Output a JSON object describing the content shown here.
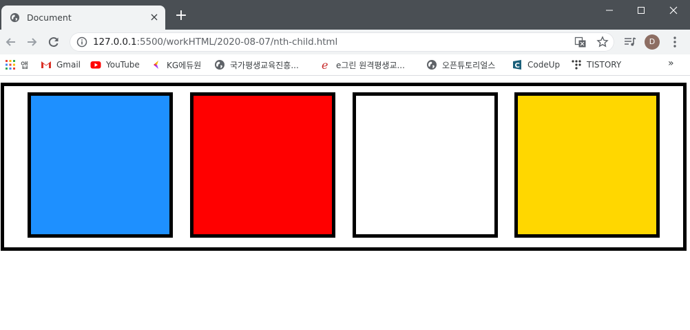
{
  "tab": {
    "title": "Document",
    "close": "×"
  },
  "new_tab": "+",
  "omnibox": {
    "host": "127.0.0.1",
    "path": ":5500/workHTML/2020-08-07/nth-child.html"
  },
  "profile": {
    "initial": "D",
    "color": "#8d6e63"
  },
  "bookmarks": [
    {
      "label": "앱",
      "icon": "apps-grid-icon"
    },
    {
      "label": "Gmail",
      "icon": "gmail-icon"
    },
    {
      "label": "YouTube",
      "icon": "youtube-icon"
    },
    {
      "label": "KG에듀원",
      "icon": "kg-icon"
    },
    {
      "label": "국가평생교육진흥...",
      "icon": "globe-icon"
    },
    {
      "label": "e그린 원격평생교...",
      "icon": "e-icon"
    },
    {
      "label": "오픈튜토리얼스",
      "icon": "globe-icon"
    },
    {
      "label": "CodeUp",
      "icon": "codeup-icon"
    },
    {
      "label": "TISTORY",
      "icon": "tistory-icon"
    }
  ],
  "bookmarks_overflow": "»",
  "page": {
    "container_border": "#000000",
    "boxes": [
      {
        "color": "#1e90ff"
      },
      {
        "color": "#ff0000"
      },
      {
        "color": "#ffffff"
      },
      {
        "color": "#ffd700"
      }
    ]
  }
}
